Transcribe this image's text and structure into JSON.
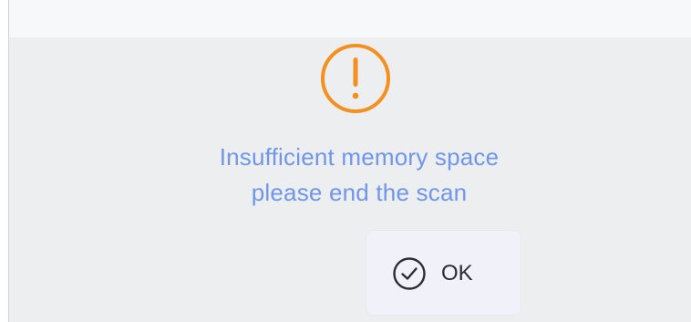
{
  "dialog": {
    "message_line_1": "Insufficient memory space",
    "message_line_2": "please end the scan",
    "warning_icon": "exclamation-circle-icon",
    "warning_color": "#f3901f",
    "message_color": "#6f96eb"
  },
  "ok_button": {
    "label": "OK",
    "icon": "check-circle-icon"
  }
}
